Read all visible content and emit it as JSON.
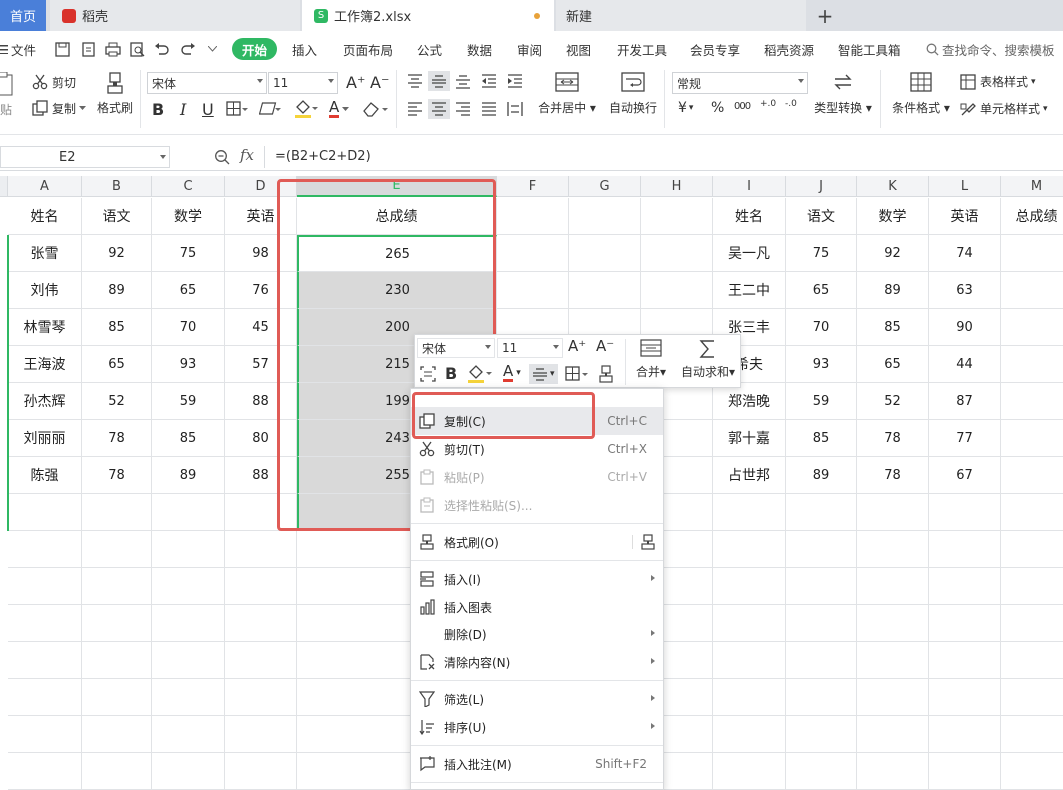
{
  "tabs": {
    "home": "首页",
    "wps": "稻壳",
    "file": "工作簿2.xlsx",
    "new": "新建",
    "plus": "+"
  },
  "menu": {
    "file": "文件",
    "items": [
      "开始",
      "插入",
      "页面布局",
      "公式",
      "数据",
      "审阅",
      "视图",
      "开发工具",
      "会员专享",
      "稻壳资源",
      "智能工具箱"
    ],
    "search": "查找命令、搜索模板"
  },
  "toolbar": {
    "paste": "贴",
    "cut": "剪切",
    "copy": "复制",
    "format_painter": "格式刷",
    "font": "宋体",
    "size": "11",
    "bold": "B",
    "italic": "I",
    "underline": "U",
    "font_color_letter": "A",
    "grow": "A⁺",
    "shrink": "A⁻",
    "merge": "合并居中",
    "wrap": "自动换行",
    "number_format": "常规",
    "currency": "¥",
    "percent": "%",
    "thousands": "000",
    "dec_add": "+.0",
    "dec_sub": "-.0",
    "convert": "类型转换",
    "cond_format": "条件格式",
    "table_style": "表格样式",
    "cell_style": "单元格样式"
  },
  "formula": {
    "namebox": "E2",
    "fx": "fx",
    "value": "=(B2+C2+D2)"
  },
  "columns": [
    "A",
    "B",
    "C",
    "D",
    "E",
    "F",
    "G",
    "H",
    "I",
    "J",
    "K",
    "L",
    "M"
  ],
  "left_table": {
    "headers": [
      "姓名",
      "语文",
      "数学",
      "英语",
      "总成绩"
    ],
    "rows": [
      [
        "张雪",
        "92",
        "75",
        "98",
        "265"
      ],
      [
        "刘伟",
        "89",
        "65",
        "76",
        "230"
      ],
      [
        "林雪琴",
        "85",
        "70",
        "45",
        "200"
      ],
      [
        "王海波",
        "65",
        "93",
        "57",
        "215"
      ],
      [
        "孙杰辉",
        "52",
        "59",
        "88",
        "199"
      ],
      [
        "刘丽丽",
        "78",
        "85",
        "80",
        "243"
      ],
      [
        "陈强",
        "78",
        "89",
        "88",
        "255"
      ]
    ]
  },
  "right_table": {
    "headers": [
      "姓名",
      "语文",
      "数学",
      "英语",
      "总成绩"
    ],
    "rows": [
      [
        "吴一凡",
        "75",
        "92",
        "74"
      ],
      [
        "王二中",
        "65",
        "89",
        "63"
      ],
      [
        "张三丰",
        "70",
        "85",
        "90"
      ],
      [
        "希夫",
        "93",
        "65",
        "44"
      ],
      [
        "郑浩晚",
        "59",
        "52",
        "87"
      ],
      [
        "郭十嘉",
        "85",
        "78",
        "77"
      ],
      [
        "占世邦",
        "89",
        "78",
        "67"
      ]
    ]
  },
  "mini_toolbar": {
    "font": "宋体",
    "size": "11",
    "bold": "B",
    "font_color_letter": "A",
    "merge": "合并",
    "autosum": "自动求和"
  },
  "context_menu": {
    "copy": "复制(C)",
    "copy_sc": "Ctrl+C",
    "cut": "剪切(T)",
    "cut_sc": "Ctrl+X",
    "paste": "粘贴(P)",
    "paste_sc": "Ctrl+V",
    "paste_special": "选择性粘贴(S)...",
    "format_painter": "格式刷(O)",
    "insert": "插入(I)",
    "insert_chart": "插入图表",
    "delete": "删除(D)",
    "clear": "清除内容(N)",
    "filter": "筛选(L)",
    "sort": "排序(U)",
    "comment": "插入批注(M)",
    "comment_sc": "Shift+F2"
  },
  "colors": {
    "accent": "#2fb863",
    "red": "#e05b56",
    "wps_red": "#d9322b"
  }
}
